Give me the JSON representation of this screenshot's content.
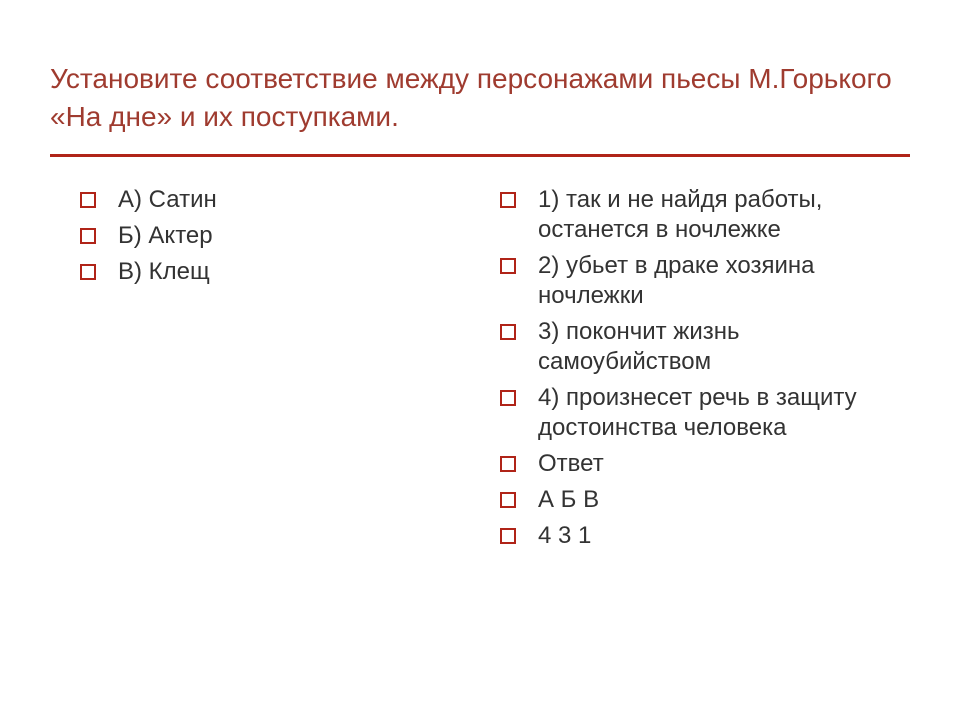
{
  "title": "Установите соответствие между персонажами пьесы М.Горького «На дне» и их поступками.",
  "left_items": [
    "А) Сатин",
    "Б) Актер",
    "В) Клещ"
  ],
  "right_items": [
    "1) так и не  найдя работы, останется в ночлежке",
    "2) убьет в драке хозяина ночлежки",
    "3) покончит жизнь самоубийством",
    "4) произнесет речь в защиту достоинства человека",
    "Ответ",
    "А   Б   В",
    "4   3   1"
  ],
  "colors": {
    "accent": "#b02418",
    "title": "#9f3b2f",
    "text": "#333333"
  }
}
